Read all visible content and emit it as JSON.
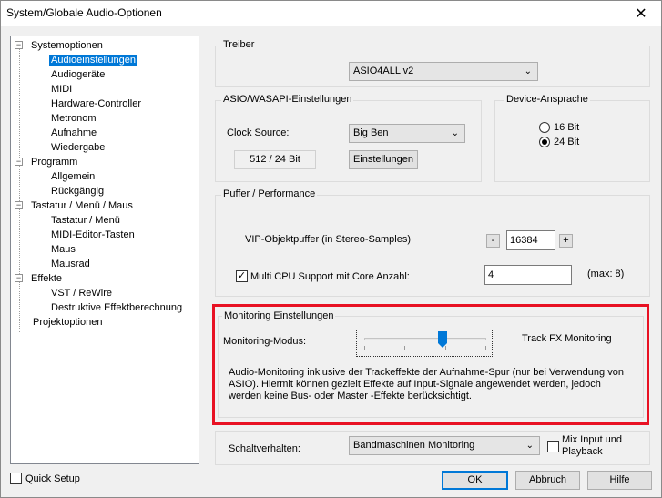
{
  "window": {
    "title": "System/Globale Audio-Optionen",
    "close_glyph": "✕"
  },
  "tree": {
    "items": [
      {
        "label": "Systemoptionen",
        "toggle": "−"
      },
      {
        "label": "Audioeinstellungen"
      },
      {
        "label": "Audiogeräte"
      },
      {
        "label": "MIDI"
      },
      {
        "label": "Hardware-Controller"
      },
      {
        "label": "Metronom"
      },
      {
        "label": "Aufnahme"
      },
      {
        "label": "Wiedergabe"
      },
      {
        "label": "Programm",
        "toggle": "−"
      },
      {
        "label": "Allgemein"
      },
      {
        "label": "Rückgängig"
      },
      {
        "label": "Tastatur / Menü / Maus",
        "toggle": "−"
      },
      {
        "label": "Tastatur / Menü"
      },
      {
        "label": "MIDI-Editor-Tasten"
      },
      {
        "label": "Maus"
      },
      {
        "label": "Mausrad"
      },
      {
        "label": "Effekte",
        "toggle": "−"
      },
      {
        "label": "VST / ReWire"
      },
      {
        "label": "Destruktive Effektberechnung"
      },
      {
        "label": "Projektoptionen"
      }
    ],
    "selected": "Audioeinstellungen"
  },
  "quick_setup": {
    "label": "Quick Setup",
    "checked": false
  },
  "treiber": {
    "group_title": "Treiber",
    "selected": "ASIO4ALL v2"
  },
  "asio": {
    "group_title": "ASIO/WASAPI-Einstellungen",
    "clock_source_label": "Clock Source:",
    "clock_source_value": "Big Ben",
    "format_value": "512 / 24 Bit",
    "settings_button": "Einstellungen"
  },
  "device": {
    "group_title": "Device-Ansprache",
    "option_16": "16 Bit",
    "option_24": "24 Bit",
    "selected": "24 Bit"
  },
  "puffer": {
    "group_title": "Puffer / Performance",
    "vip_label": "VIP-Objektpuffer (in Stereo-Samples)",
    "minus": "-",
    "plus": "+",
    "vip_value": "16384",
    "multi_cpu_label": "Multi CPU Support mit Core Anzahl:",
    "multi_cpu_checked": true,
    "core_value": "4",
    "max_label": "(max: 8)"
  },
  "monitoring": {
    "group_title": "Monitoring Einstellungen",
    "mode_label": "Monitoring-Modus:",
    "mode_value": "Track FX Monitoring",
    "slider_level": 0.75,
    "description": "Audio-Monitoring inklusive der Trackeffekte der Aufnahme-Spur (nur bei Verwendung von ASIO). Hiermit können gezielt Effekte auf Input-Signale angewendet werden, jedoch werden keine Bus- oder Master -Effekte berücksichtigt.",
    "highlight_color": "#e81123"
  },
  "schaltverhalten": {
    "label": "Schaltverhalten:",
    "value": "Bandmaschinen Monitoring",
    "mix_input_label": "Mix Input und Playback",
    "mix_input_checked": false
  },
  "buttons": {
    "ok": "OK",
    "abbruch": "Abbruch",
    "hilfe": "Hilfe"
  },
  "colors": {
    "selection": "#0078d7",
    "accent_thumb": "#0078d7"
  }
}
